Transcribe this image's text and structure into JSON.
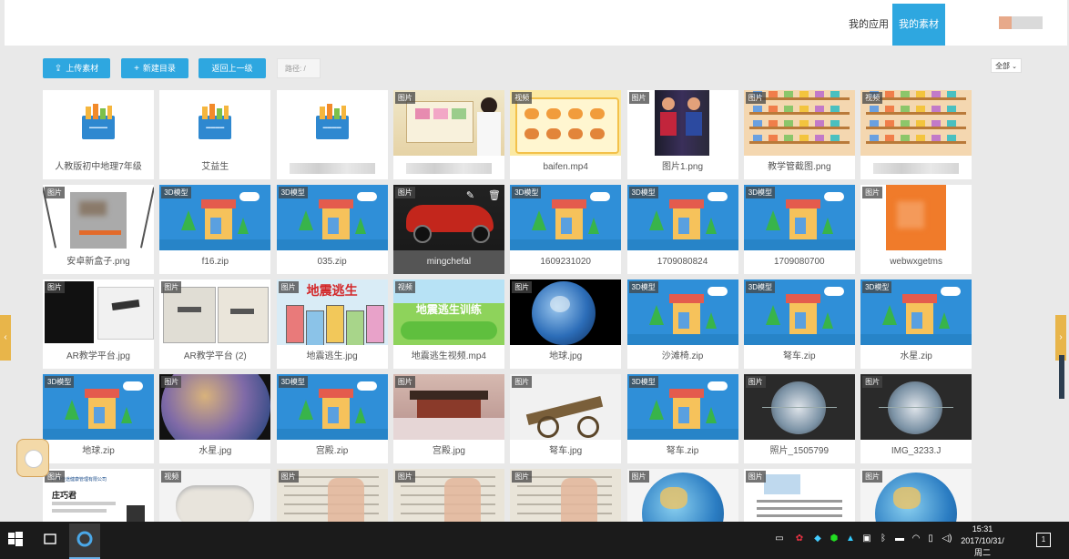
{
  "topbar": {
    "my_apps": "我的应用",
    "my_materials": "我的素材"
  },
  "toolbar": {
    "upload_label": "上传素材",
    "new_dir_label": "新建目录",
    "back_label": "返回上一级",
    "path_label": "路径: /",
    "filter_value": "全部"
  },
  "tiles": [
    {
      "caption": "人教版初中地理7年级",
      "type": "folder",
      "badge": ""
    },
    {
      "caption": "艾益生",
      "type": "folder",
      "badge": ""
    },
    {
      "caption": "",
      "type": "folder",
      "badge": "",
      "blur": true
    },
    {
      "caption": "",
      "type": "photo-classroom",
      "badge": "图片",
      "blur": true
    },
    {
      "caption": "baifen.mp4",
      "type": "video-yellow",
      "badge": "视频"
    },
    {
      "caption": "图片1.png",
      "type": "photo-people",
      "badge": "图片"
    },
    {
      "caption": "教学管截图.png",
      "type": "shelf",
      "badge": "图片"
    },
    {
      "caption": "",
      "type": "shelf",
      "badge": "视频",
      "blur": true
    },
    {
      "caption": "安卓新盒子.png",
      "type": "photo-box",
      "badge": "图片"
    },
    {
      "caption": "f16.zip",
      "type": "model3d",
      "badge": "3D模型"
    },
    {
      "caption": "035.zip",
      "type": "model3d",
      "badge": "3D模型"
    },
    {
      "caption": "mingchefal",
      "type": "photo-car",
      "badge": "图片",
      "hover": true
    },
    {
      "caption": "1609231020",
      "type": "model3d",
      "badge": "3D模型"
    },
    {
      "caption": "1709080824",
      "type": "model3d",
      "badge": "3D模型"
    },
    {
      "caption": "1709080700",
      "type": "model3d",
      "badge": "3D模型"
    },
    {
      "caption": "webwxgetms",
      "type": "photo-orange",
      "badge": "图片"
    },
    {
      "caption": "AR教学平台.jpg",
      "type": "screen",
      "badge": "图片"
    },
    {
      "caption": "AR教学平台 (2)",
      "type": "screen-plane",
      "badge": "图片"
    },
    {
      "caption": "地震逃生.jpg",
      "type": "cartoon",
      "badge": "图片"
    },
    {
      "caption": "地震逃生视频.mp4",
      "type": "video-green",
      "badge": "视频"
    },
    {
      "caption": "地球.jpg",
      "type": "earth",
      "badge": "图片"
    },
    {
      "caption": "沙滩椅.zip",
      "type": "model3d",
      "badge": "3D模型"
    },
    {
      "caption": "弩车.zip",
      "type": "model3d",
      "badge": "3D模型"
    },
    {
      "caption": "水星.zip",
      "type": "model3d",
      "badge": "3D模型"
    },
    {
      "caption": "地球.zip",
      "type": "model3d",
      "badge": "3D模型"
    },
    {
      "caption": "水星.jpg",
      "type": "mercury",
      "badge": "图片"
    },
    {
      "caption": "宫殿.zip",
      "type": "model3d",
      "badge": "3D模型"
    },
    {
      "caption": "宫殿.jpg",
      "type": "palace",
      "badge": "图片"
    },
    {
      "caption": "弩车.jpg",
      "type": "catapult",
      "badge": "图片"
    },
    {
      "caption": "弩车.zip",
      "type": "model3d",
      "badge": "3D模型"
    },
    {
      "caption": "照片_1505799",
      "type": "globe-dark",
      "badge": "图片"
    },
    {
      "caption": "IMG_3233.J",
      "type": "globe-dark",
      "badge": "图片"
    },
    {
      "caption": "",
      "type": "card",
      "badge": "图片"
    },
    {
      "caption": "",
      "type": "device",
      "badge": "视频"
    },
    {
      "caption": "",
      "type": "book",
      "badge": "图片"
    },
    {
      "caption": "",
      "type": "book",
      "badge": "图片"
    },
    {
      "caption": "",
      "type": "book",
      "badge": "图片"
    },
    {
      "caption": "",
      "type": "globe",
      "badge": "图片"
    },
    {
      "caption": "",
      "type": "doc",
      "badge": "图片"
    },
    {
      "caption": "",
      "type": "globe",
      "badge": "图片"
    }
  ],
  "thumb_text": {
    "folder_label": "▬▬▬▬",
    "cartoon_title": "地震逃生",
    "video_green_title": "地震逃生训练",
    "card_name": "庄巧君",
    "card_company": "广州佳途健康管理有限公司"
  },
  "taskbar": {
    "time": "15:31",
    "date": "2017/10/31/周二",
    "notif_count": "1"
  },
  "colors": {
    "accent": "#2ea7e0",
    "model_bg": "#2f8fd8",
    "taskbar": "#1b1b1b"
  }
}
